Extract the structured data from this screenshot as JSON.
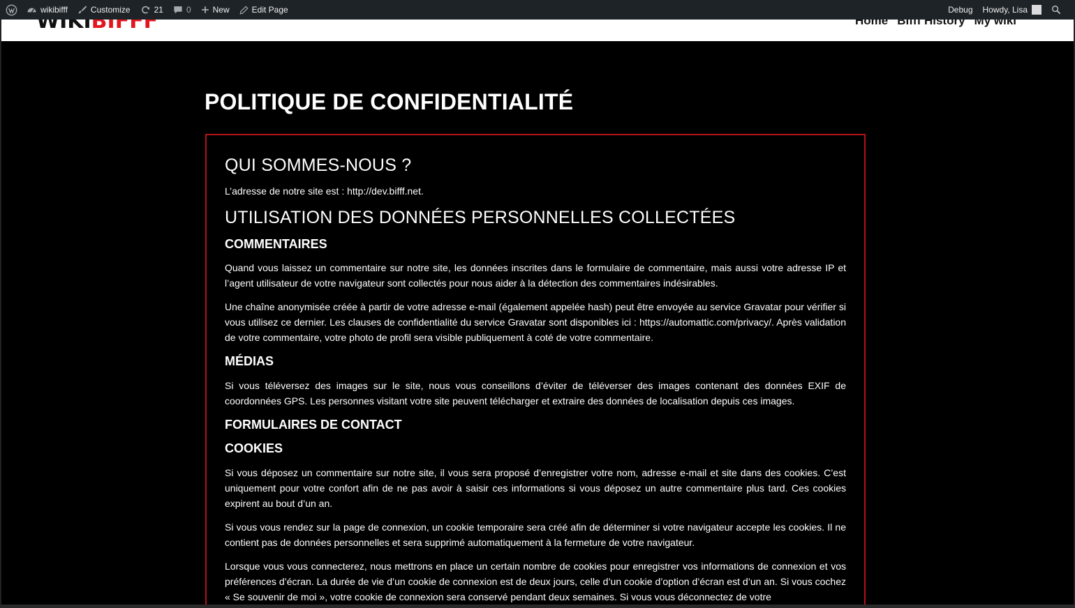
{
  "adminbar": {
    "site_name": "wikibifff",
    "customize": "Customize",
    "updates_count": "21",
    "comments_count": "0",
    "new_label": "New",
    "edit_page": "Edit Page",
    "debug": "Debug",
    "howdy": "Howdy, Lisa"
  },
  "header": {
    "logo_wiki": "WIKI",
    "logo_bifff": "BIFFF",
    "nav": [
      "Home",
      "Bifff History",
      "My wiki"
    ]
  },
  "page": {
    "title": "POLITIQUE DE CONFIDENTIALITÉ",
    "sections": {
      "who_heading": "QUI SOMMES-NOUS ?",
      "who_text": "L’adresse de notre site est : http://dev.bifff.net.",
      "usage_heading": "UTILISATION DES DONNÉES PERSONNELLES COLLECTÉES",
      "comments_heading": "COMMENTAIRES",
      "comments_p1": "Quand vous laissez un commentaire sur notre site, les données inscrites dans le formulaire de commentaire, mais aussi votre adresse IP et l’agent utilisateur de votre navigateur sont collectés pour nous aider à la détection des commentaires indésirables.",
      "comments_p2": "Une chaîne anonymisée créée à partir de votre adresse e-mail (également appelée hash) peut être envoyée au service Gravatar pour vérifier si vous utilisez ce dernier. Les clauses de confidentialité du service Gravatar sont disponibles ici : https://automattic.com/privacy/. Après validation de votre commentaire, votre photo de profil sera visible publiquement à coté de votre commentaire.",
      "media_heading": "MÉDIAS",
      "media_p1": "Si vous téléversez des images sur le site, nous vous conseillons d’éviter de téléverser des images contenant des données EXIF de coordonnées GPS. Les personnes visitant votre site peuvent télécharger et extraire des données de localisation depuis ces images.",
      "forms_heading": "FORMULAIRES DE CONTACT",
      "cookies_heading": "COOKIES",
      "cookies_p1": "Si vous déposez un commentaire sur notre site, il vous sera proposé d’enregistrer votre nom, adresse e-mail et site dans des cookies. C’est uniquement pour votre confort afin de ne pas avoir à saisir ces informations si vous déposez un autre commentaire plus tard. Ces cookies expirent au bout d’un an.",
      "cookies_p2": "Si vous vous rendez sur la page de connexion, un cookie temporaire sera créé afin de déterminer si votre navigateur accepte les cookies. Il ne contient pas de données personnelles et sera supprimé automatiquement à la fermeture de votre navigateur.",
      "cookies_p3": "Lorsque vous vous connecterez, nous mettrons en place un certain nombre de cookies pour enregistrer vos informations de connexion et vos préférences d’écran. La durée de vie d’un cookie de connexion est de deux jours, celle d’un cookie d’option d’écran est d’un an. Si vous cochez « Se souvenir de moi », votre cookie de connexion sera conservé pendant deux semaines. Si vous vous déconnectez de votre"
    }
  }
}
